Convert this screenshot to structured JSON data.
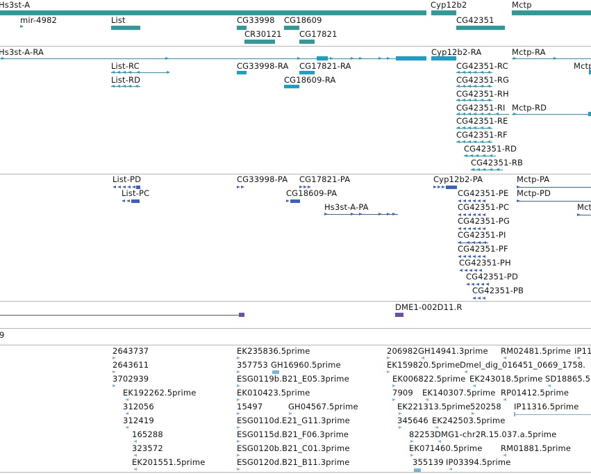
{
  "colors": {
    "gene": "#2f9a9a",
    "transcript": "#1a9fc9",
    "protein": "#3b5fc8",
    "clone": "#6b4fa8",
    "est": "#77b4dc",
    "divider": "#b4b4b4"
  },
  "genes": [
    {
      "label": "Hs3st-A",
      "name": "gene-hs3st-a"
    },
    {
      "label": "Cyp12b2",
      "name": "gene-cyp12b2"
    },
    {
      "label": "Mctp",
      "name": "gene-mctp"
    },
    {
      "label": "mir-4982",
      "name": "gene-mir-4982"
    },
    {
      "label": "List",
      "name": "gene-list"
    },
    {
      "label": "CG33998",
      "name": "gene-cg33998"
    },
    {
      "label": "CG18609",
      "name": "gene-cg18609"
    },
    {
      "label": "CG42351",
      "name": "gene-cg42351"
    },
    {
      "label": "CR30121",
      "name": "gene-cr30121"
    },
    {
      "label": "CG17821",
      "name": "gene-cg17821"
    }
  ],
  "transcripts": [
    {
      "label": "Hs3st-A-RA"
    },
    {
      "label": "Cyp12b2-RA"
    },
    {
      "label": "Mctp-RA"
    },
    {
      "label": "List-RC"
    },
    {
      "label": "CG33998-RA"
    },
    {
      "label": "CG17821-RA"
    },
    {
      "label": "CG42351-RC"
    },
    {
      "label": "Mctp"
    },
    {
      "label": "List-RD"
    },
    {
      "label": "CG18609-RA"
    },
    {
      "label": "CG42351-RG"
    },
    {
      "label": "CG42351-RH"
    },
    {
      "label": "CG42351-RI"
    },
    {
      "label": "Mctp-RD"
    },
    {
      "label": "CG42351-RE"
    },
    {
      "label": "CG42351-RF"
    },
    {
      "label": "CG42351-RD"
    },
    {
      "label": "CG42351-RB"
    }
  ],
  "proteins": [
    {
      "label": "List-PD"
    },
    {
      "label": "CG33998-PA"
    },
    {
      "label": "CG17821-PA"
    },
    {
      "label": "Cyp12b2-PA"
    },
    {
      "label": "Mctp-PA"
    },
    {
      "label": "List-PC"
    },
    {
      "label": "CG18609-PA"
    },
    {
      "label": "CG42351-PE"
    },
    {
      "label": "Mctp-PD"
    },
    {
      "label": "Hs3st-A-PA"
    },
    {
      "label": "CG42351-PC"
    },
    {
      "label": "Mct"
    },
    {
      "label": "CG42351-PG"
    },
    {
      "label": "CG42351-PI"
    },
    {
      "label": "CG42351-PF"
    },
    {
      "label": "CG42351-PH"
    },
    {
      "label": "CG42351-PD"
    },
    {
      "label": "CG42351-PB"
    }
  ],
  "clones": [
    {
      "label": "DME1-002D11.R"
    }
  ],
  "axis": {
    "label": "9"
  },
  "ests": [
    {
      "label": "2643737"
    },
    {
      "label": "EK235836.5prime"
    },
    {
      "label": "206982"
    },
    {
      "label": "GH14941.3prime"
    },
    {
      "label": "RM02481.5prime"
    },
    {
      "label": "IP11"
    },
    {
      "label": "2643611"
    },
    {
      "label": "357753"
    },
    {
      "label": "GH16960.5prime"
    },
    {
      "label": "EK159820.5prime"
    },
    {
      "label": "Dmel_dig_016451_0669_1758."
    },
    {
      "label": "3702939"
    },
    {
      "label": "ESG0119b.B21_E05.3prime"
    },
    {
      "label": "EK006822.5prime"
    },
    {
      "label": "EK243018.5prime"
    },
    {
      "label": "SD18865.5"
    },
    {
      "label": "EK192262.5prime"
    },
    {
      "label": "EK010423.5prime"
    },
    {
      "label": "7909"
    },
    {
      "label": "EK140307.5prime"
    },
    {
      "label": "RP01412.5prime"
    },
    {
      "label": "312056"
    },
    {
      "label": "15497"
    },
    {
      "label": "GH04567.5prime"
    },
    {
      "label": "EK221313.5prime"
    },
    {
      "label": "520258"
    },
    {
      "label": "IP11316.5prime"
    },
    {
      "label": "312419"
    },
    {
      "label": "ESG0110d.E21_G11.3prime"
    },
    {
      "label": "345646"
    },
    {
      "label": "EK242503.5prime"
    },
    {
      "label": "165288"
    },
    {
      "label": "ESG0115d.B21_F06.3prime"
    },
    {
      "label": "82253"
    },
    {
      "label": "DMG1-chr2R.15.037.a.5prime"
    },
    {
      "label": "323572"
    },
    {
      "label": "ESG0120b.B21_C01.3prime"
    },
    {
      "label": "EK071460.5prime"
    },
    {
      "label": "RM01881.5prime"
    },
    {
      "label": "EK201551.5prime"
    },
    {
      "label": "ESG0120d.B21_B11.3prime"
    },
    {
      "label": "355139"
    },
    {
      "label": "IP03394.5prime"
    }
  ]
}
